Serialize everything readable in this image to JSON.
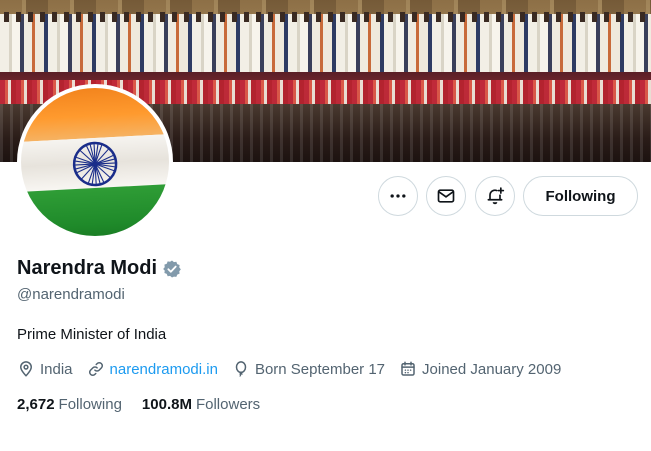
{
  "profile": {
    "name": "Narendra Modi",
    "handle": "@narendramodi",
    "bio": "Prime Minister of India",
    "location": "India",
    "website": "narendramodi.in",
    "birthday": "Born September 17",
    "joined": "Joined January 2009",
    "verified": true
  },
  "stats": {
    "following_count": "2,672",
    "following_label": "Following",
    "followers_count": "100.8M",
    "followers_label": "Followers"
  },
  "actions": {
    "follow_label": "Following",
    "more_icon": "more-icon",
    "message_icon": "mail-icon",
    "notify_icon": "bell-plus-icon"
  },
  "colors": {
    "accent": "#1d9bf0",
    "text_primary": "#0f1419",
    "text_secondary": "#536471",
    "border": "#cfd9de"
  }
}
